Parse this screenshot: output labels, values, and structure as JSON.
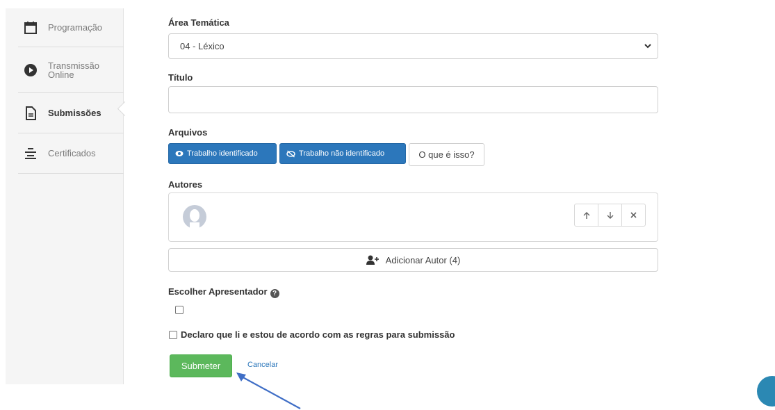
{
  "sidebar": {
    "items": [
      {
        "label": "Programação",
        "icon": "calendar-icon"
      },
      {
        "label": "Transmissão\nOnline",
        "icon": "play-circle-icon"
      },
      {
        "label": "Submissões",
        "icon": "document-icon",
        "active": true
      },
      {
        "label": "Certificados",
        "icon": "align-center-icon"
      }
    ]
  },
  "form": {
    "area_label": "Área Temática",
    "area_value": "04 - Léxico",
    "title_label": "Título",
    "title_value": "",
    "files_label": "Arquivos",
    "files_buttons": {
      "identified": "Trabalho identificado",
      "unidentified": "Trabalho não identificado",
      "what_is": "O que é isso?"
    },
    "authors_label": "Autores",
    "add_author": "Adicionar Autor (4)",
    "presenter_label": "Escolher Apresentador",
    "declare_label": "Declaro que li e estou de acordo com as regras para submissão",
    "submit": "Submeter",
    "cancel": "Cancelar"
  },
  "colors": {
    "primary": "#2c77bb",
    "success": "#5cb85c",
    "accent_circle": "#2b88b3"
  }
}
